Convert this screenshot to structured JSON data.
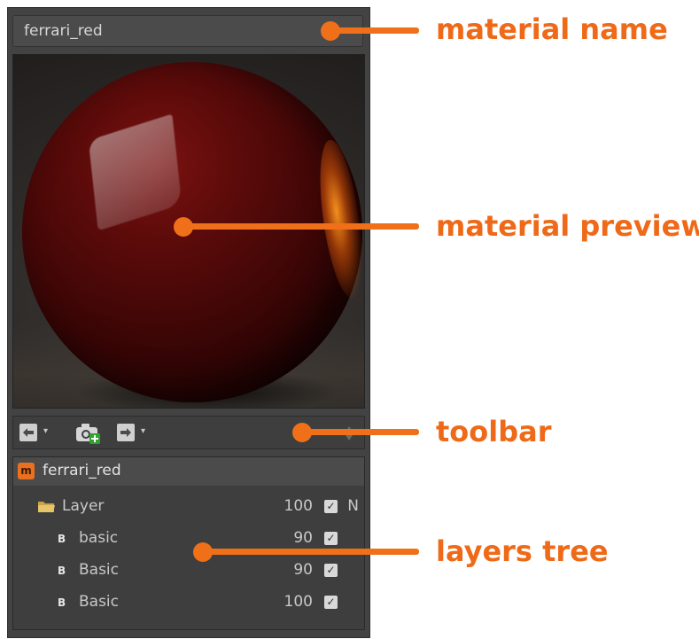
{
  "material_name": "ferrari_red",
  "toolbar": {
    "back_icon": "arrow-left-icon",
    "forward_icon": "arrow-right-icon",
    "camera_icon": "camera-add-icon",
    "sort_icon": "up-down-icon"
  },
  "tree": {
    "root": {
      "label": "ferrari_red",
      "badge": "m"
    },
    "rows": [
      {
        "type": "folder",
        "label": "Layer",
        "value": "100",
        "flag": "N"
      },
      {
        "type": "basic",
        "badge": "B",
        "label": "basic",
        "value": "90"
      },
      {
        "type": "basic",
        "badge": "B",
        "label": "Basic",
        "value": "90"
      },
      {
        "type": "basic",
        "badge": "B",
        "label": "Basic",
        "value": "100"
      }
    ]
  },
  "annotations": {
    "material_name": "material name",
    "material_preview": "material preview",
    "toolbar": "toolbar",
    "layers_tree": "layers tree"
  },
  "colors": {
    "accent": "#f07019",
    "panel_bg": "#434343",
    "material_badge": "#e8701e"
  }
}
